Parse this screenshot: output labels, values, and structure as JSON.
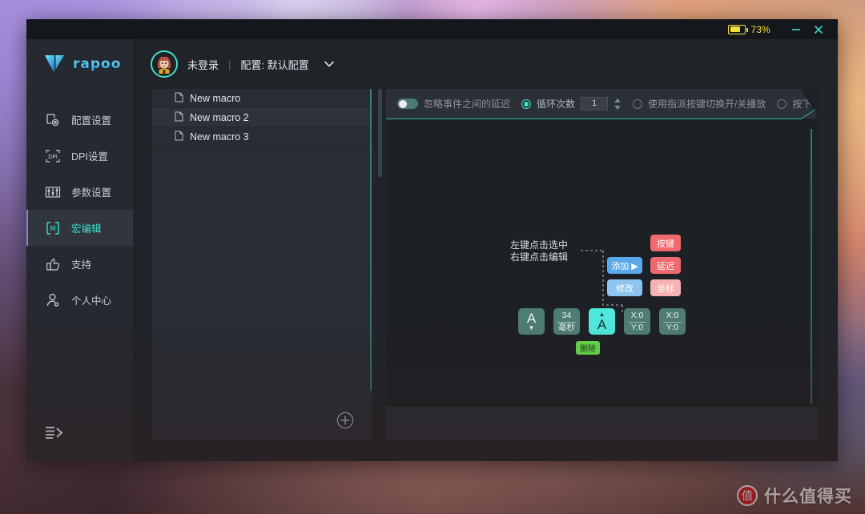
{
  "window": {
    "battery_percent": "73%",
    "minimize_label": "minimize",
    "close_label": "close"
  },
  "sidebar": {
    "brand": "rapoo",
    "items": [
      {
        "label": "配置设置",
        "icon": "config-icon",
        "active": false
      },
      {
        "label": "DPI设置",
        "icon": "dpi-icon",
        "active": false
      },
      {
        "label": "参数设置",
        "icon": "sliders-icon",
        "active": false
      },
      {
        "label": "宏编辑",
        "icon": "macro-icon",
        "active": true
      },
      {
        "label": "支持",
        "icon": "thumbs-up-icon",
        "active": false
      },
      {
        "label": "个人中心",
        "icon": "user-icon",
        "active": false
      }
    ],
    "collapse_label": "collapse-menu"
  },
  "topbar": {
    "login_status": "未登录",
    "divider": "|",
    "profile_label": "配置: 默认配置"
  },
  "macro_list": {
    "items": [
      {
        "name": "New macro"
      },
      {
        "name": "New macro 2"
      },
      {
        "name": "New macro 3"
      }
    ],
    "add_label": "+"
  },
  "editor": {
    "toolbar": {
      "ignore_delay_label": "忽略事件之间的延迟",
      "loop_count_label": "循环次数",
      "loop_count_value": "1",
      "toggle_key_label": "使用指派按键切换开/关播放",
      "press_play_label": "按下时播放"
    },
    "diagram": {
      "tip_line1": "左键点击选中",
      "tip_line2": "右键点击编辑",
      "chips": {
        "add": "添加 ▶",
        "modify": "修改",
        "key": "按键",
        "delay": "延迟",
        "coord": "坐标"
      },
      "keys": [
        {
          "type": "key",
          "glyph": "A",
          "arrow": "▼",
          "selected": false
        },
        {
          "type": "delay",
          "line1": "34",
          "line2": "毫秒",
          "selected": false
        },
        {
          "type": "key",
          "glyph": "A",
          "arrow": "▲",
          "selected": true
        },
        {
          "type": "coord",
          "line1": "X:0",
          "line2": "Y:0",
          "selected": false
        },
        {
          "type": "coord",
          "line1": "X:0",
          "line2": "Y:0",
          "selected": false
        }
      ],
      "delete_label": "删除"
    }
  },
  "watermark": {
    "badge": "值",
    "text": "什么值得买"
  },
  "colors": {
    "accent_teal": "#3fe0cd",
    "brand_blue": "#2b9fe8",
    "battery_yellow": "#f2e03a",
    "chip_blue": "#5aa9ea",
    "chip_blue_light": "#8dc5f0",
    "chip_red": "#f0696e",
    "chip_pink": "#f6b2b4",
    "chip_green": "#63d94a",
    "key_teal": "#4e7d74",
    "key_selected": "#4fe8dd"
  }
}
